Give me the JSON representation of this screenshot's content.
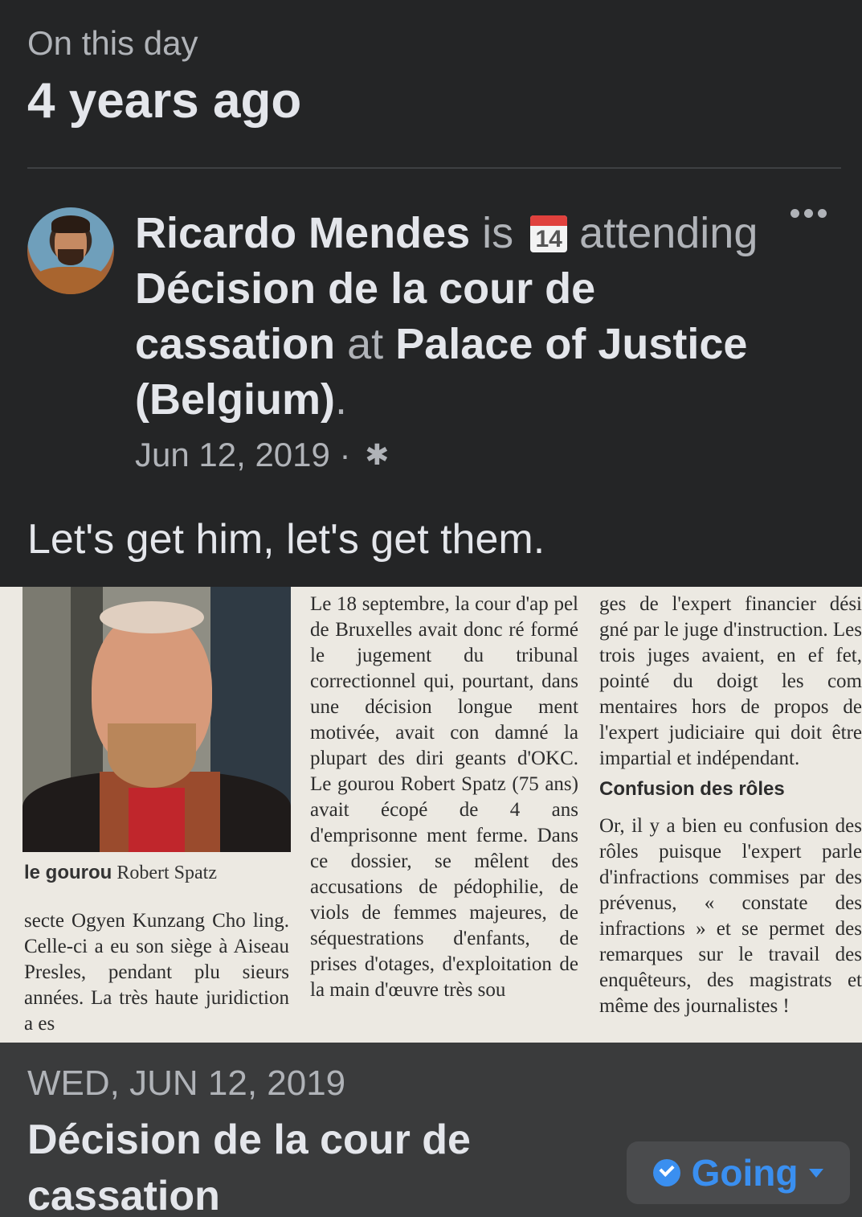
{
  "header": {
    "subtitle": "On this day",
    "title": "4 years ago"
  },
  "post": {
    "author": "Ricardo Mendes",
    "verb_is": "is",
    "calendar_number": "14",
    "verb_attending": "attending",
    "event_name": "Décision de la cour de cassation",
    "at": "at",
    "place": "Palace of Justice (Belgium)",
    "period": ".",
    "date": "Jun 12, 2019",
    "separator": "·",
    "privacy_icon": "gear-icon",
    "caption": "Let's get him, let's get them."
  },
  "article": {
    "photo_caption_bold": "le gourou",
    "photo_caption": "Robert Spatz",
    "col1": "secte Ogyen Kunzang Cho ling. Celle-ci a eu son siège à Aiseau Presles, pendant plu sieurs années. La très haute juridiction a es",
    "col2": "Le 18 septembre, la cour d'ap pel de Bruxelles avait donc ré formé le jugement du tribunal correctionnel qui, pourtant, dans une décision longue ment motivée, avait con damné la plupart des diri geants d'OKC. Le gourou Robert Spatz (75 ans) avait écopé de 4 ans d'emprisonne ment ferme. Dans ce dossier, se mêlent des accusations de pédophilie, de viols de femmes majeures, de séquestrations d'enfants, de prises d'otages, d'exploitation de la main d'œuvre très sou",
    "col3a": "ges de l'expert financier dési gné par le juge d'instruction. Les trois juges avaient, en ef fet, pointé du doigt les com mentaires hors de propos de l'expert judiciaire qui doit être impartial et indépendant.",
    "col3_heading": "Confusion des rôles",
    "col3b": "Or, il y a bien eu confusion des rôles puisque l'expert parle d'infractions commises par des prévenus, « constate des infractions » et se permet des remarques sur le travail des enquêteurs, des magistrats et même des journalistes !"
  },
  "event": {
    "date": "WED, JUN 12, 2019",
    "title": "Décision de la cour de cassation",
    "rsvp_label": "Going"
  },
  "colors": {
    "background": "#242526",
    "event_bar": "#3a3b3c",
    "accent": "#3a8ff0"
  }
}
